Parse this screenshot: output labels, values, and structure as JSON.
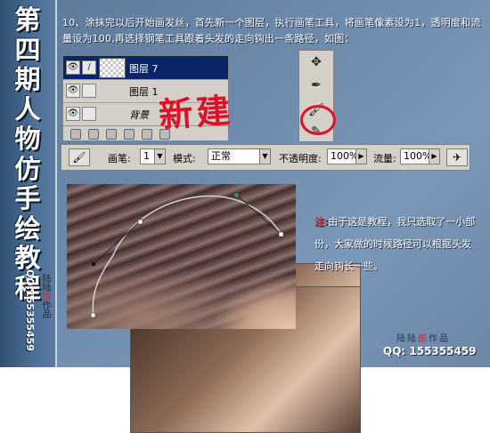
{
  "sidebar": {
    "title_chars": [
      "第",
      "四",
      "期",
      "人",
      "物",
      "仿",
      "手",
      "绘",
      "教",
      "程"
    ],
    "qq": "QQ:155355459",
    "stamp": {
      "left": "陆陆",
      "hi": "居",
      "right": "作品"
    }
  },
  "instruction": "10、涂抹完以后开始画发丝，首先新一个图层，执行画笔工具，将画笔像素设为1，透明度和流量设为100,再选择钢笔工具跟着头发的走向钩出一条路径，如图：",
  "layers_panel": {
    "rows": [
      {
        "name": "图层 7",
        "selected": true
      },
      {
        "name": "图层 1",
        "selected": false
      },
      {
        "name": "背景",
        "selected": false
      }
    ]
  },
  "annotation": {
    "red_word": "新建"
  },
  "options_bar": {
    "brush_label": "画笔:",
    "brush_size": "1",
    "mode_label": "模式:",
    "mode_value": "正常",
    "opacity_label": "不透明度:",
    "opacity_value": "100%",
    "flow_label": "流量:",
    "flow_value": "100%"
  },
  "note": {
    "label": "注:",
    "text": "由于这是教程，我只选取了一小部份，大家做的时候路径可以根据头发走向钩长一些。"
  },
  "footer": {
    "stamp": {
      "left": "陆陆",
      "hi": "居",
      "right": "作品"
    },
    "qq": "QQ: 155355459"
  },
  "colors": {
    "accent_red": "#e0102a",
    "selection_blue": "#0a246a"
  }
}
